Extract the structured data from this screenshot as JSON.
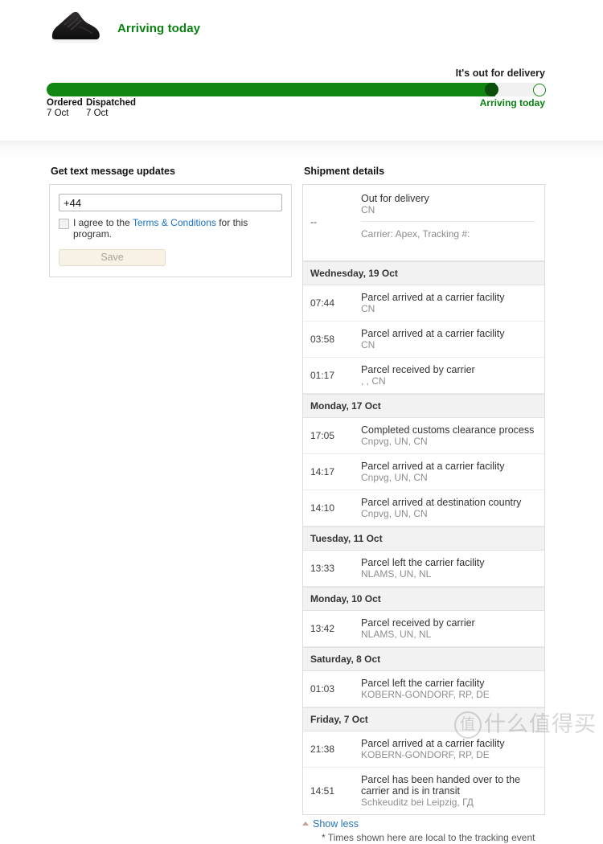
{
  "header": {
    "product_icon": "sneaker-image",
    "status": "Arriving today",
    "status_color": "#0a8013"
  },
  "progress": {
    "top_label": "It's out for delivery",
    "fill_percent": 90,
    "fill_color": "#118612",
    "dot_color": "#0b4d0b",
    "track_color": "#f1f1f1",
    "stops": [
      {
        "name": "Ordered",
        "date": "7 Oct"
      },
      {
        "name": "Dispatched",
        "date": "7 Oct"
      }
    ],
    "final_label": "Arriving today"
  },
  "sms": {
    "title": "Get text message updates",
    "phone_value": "+44",
    "phone_placeholder": "+44",
    "agree_prefix": "I agree to the ",
    "agree_link": "Terms & Conditions",
    "agree_suffix": " for this program.",
    "save_label": "Save",
    "checkbox_checked": false
  },
  "shipment": {
    "title": "Shipment details",
    "summary": {
      "time": "--",
      "status": "Out for delivery",
      "location": "CN",
      "carrier": "Carrier: Apex, Tracking #:"
    },
    "groups": [
      {
        "day": "Wednesday, 19 Oct",
        "events": [
          {
            "time": "07:44",
            "title": "Parcel arrived at a carrier facility",
            "location": "CN"
          },
          {
            "time": "03:58",
            "title": "Parcel arrived at a carrier facility",
            "location": "CN"
          },
          {
            "time": "01:17",
            "title": "Parcel received by carrier",
            "location": ", , CN"
          }
        ]
      },
      {
        "day": "Monday, 17 Oct",
        "events": [
          {
            "time": "17:05",
            "title": "Completed customs clearance process",
            "location": "Cnpvg, UN, CN"
          },
          {
            "time": "14:17",
            "title": "Parcel arrived at a carrier facility",
            "location": "Cnpvg, UN, CN"
          },
          {
            "time": "14:10",
            "title": "Parcel arrived at destination country",
            "location": "Cnpvg, UN, CN"
          }
        ]
      },
      {
        "day": "Tuesday, 11 Oct",
        "events": [
          {
            "time": "13:33",
            "title": "Parcel left the carrier facility",
            "location": "NLAMS, UN, NL"
          }
        ]
      },
      {
        "day": "Monday, 10 Oct",
        "events": [
          {
            "time": "13:42",
            "title": "Parcel received by carrier",
            "location": "NLAMS, UN, NL"
          }
        ]
      },
      {
        "day": "Saturday, 8 Oct",
        "events": [
          {
            "time": "01:03",
            "title": "Parcel left the carrier facility",
            "location": "KOBERN-GONDORF, RP, DE"
          }
        ]
      },
      {
        "day": "Friday, 7 Oct",
        "events": [
          {
            "time": "21:38",
            "title": "Parcel arrived at a carrier facility",
            "location": "KOBERN-GONDORF, RP, DE"
          },
          {
            "time": "14:51",
            "title": "Parcel has been handed over to the carrier and is in transit",
            "location": "Schkeuditz bei Leipzig, ГД"
          }
        ]
      }
    ],
    "show_less_label": "Show less",
    "footnote": "* Times shown here are local to the tracking event"
  },
  "watermark": {
    "mark": "值",
    "text": "什么值得买"
  }
}
